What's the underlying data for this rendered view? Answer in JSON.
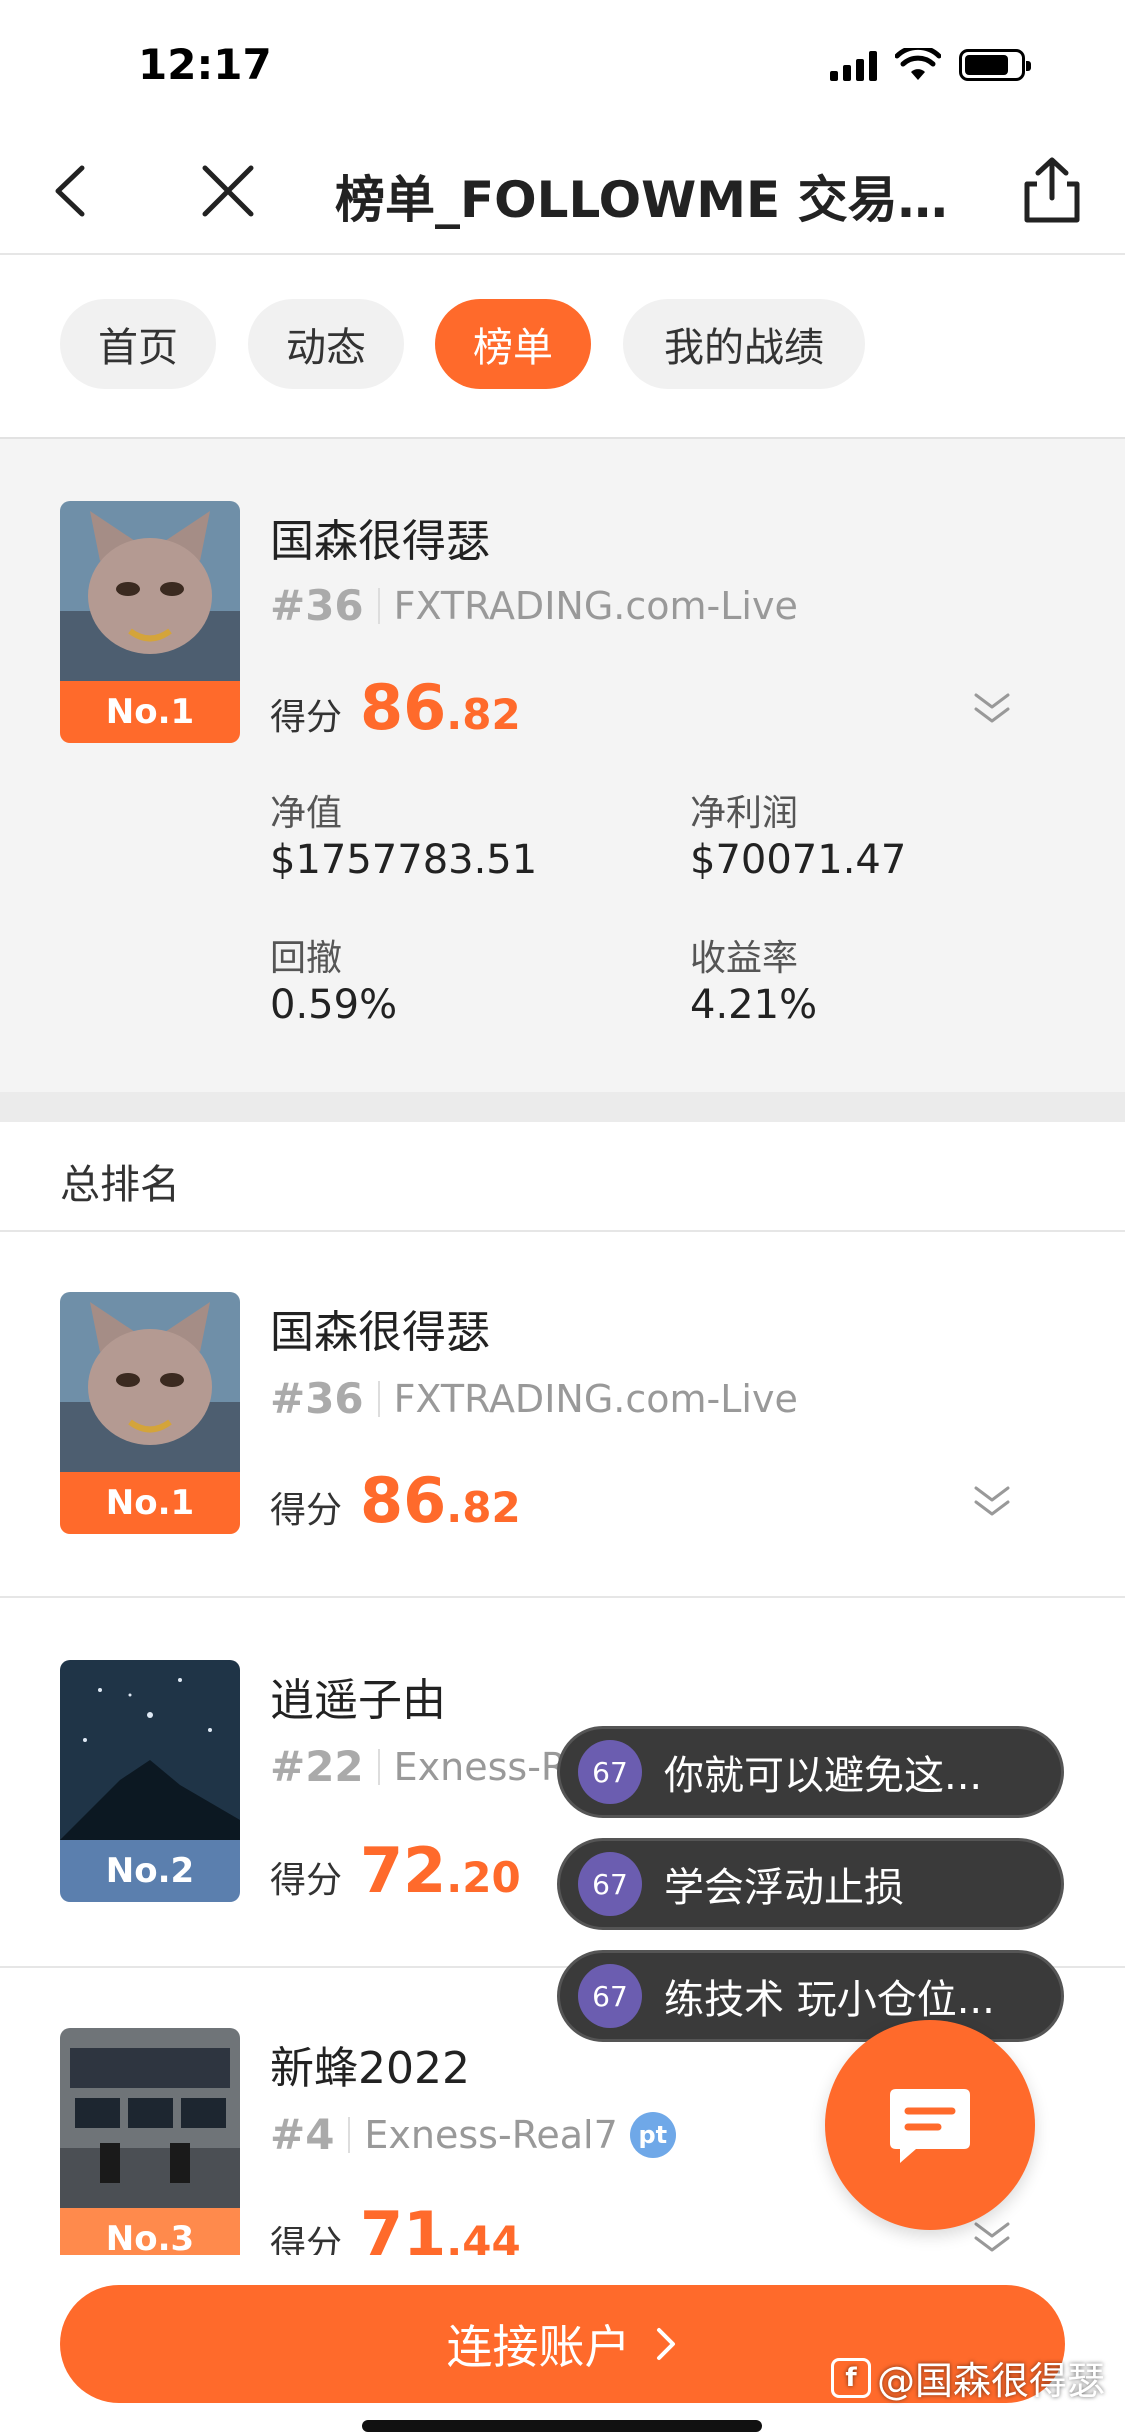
{
  "status_bar": {
    "time": "12:17"
  },
  "nav": {
    "title": "榜单_FOLLOWME 交易社区"
  },
  "tabs": [
    {
      "label": "首页"
    },
    {
      "label": "动态"
    },
    {
      "label": "榜单"
    },
    {
      "label": "我的战绩"
    }
  ],
  "featured": {
    "name": "国森很得瑟",
    "rank_label": "No.1",
    "rank_num": "#36",
    "server": "FXTRADING.com-Live",
    "score_label": "得分",
    "score_int": "86",
    "score_dec": ".82",
    "stats": {
      "equity_label": "净值",
      "equity_value": "$1757783.51",
      "profit_label": "净利润",
      "profit_value": "$70071.47",
      "drawdown_label": "回撤",
      "drawdown_value": "0.59%",
      "return_label": "收益率",
      "return_value": "4.21%"
    }
  },
  "section": {
    "title": "总排名"
  },
  "ranking": [
    {
      "name": "国森很得瑟",
      "rank_label": "No.1",
      "rank_num": "#36",
      "server": "FXTRADING.com-Live",
      "score_label": "得分",
      "score_int": "86",
      "score_dec": ".82"
    },
    {
      "name": "逍遥子由",
      "rank_label": "No.2",
      "rank_num": "#22",
      "server": "Exness-Real",
      "score_label": "得分",
      "score_int": "72",
      "score_dec": ".20"
    },
    {
      "name": "新蜂2022",
      "rank_label": "No.3",
      "rank_num": "#4",
      "server": "Exness-Real7",
      "badge": "pt",
      "score_label": "得分",
      "score_int": "71",
      "score_dec": ".44"
    }
  ],
  "bubbles": [
    {
      "count": "67",
      "text": "你就可以避免这..."
    },
    {
      "count": "67",
      "text": "学会浮动止损"
    },
    {
      "count": "67",
      "text": "练技术 玩小仓位..."
    }
  ],
  "bottom": {
    "connect_label": "连接账户",
    "watermark": "@国森很得瑟"
  },
  "colors": {
    "accent": "#ff6a2b",
    "rank2": "#5b7fae",
    "badge": "#6b5db0"
  }
}
